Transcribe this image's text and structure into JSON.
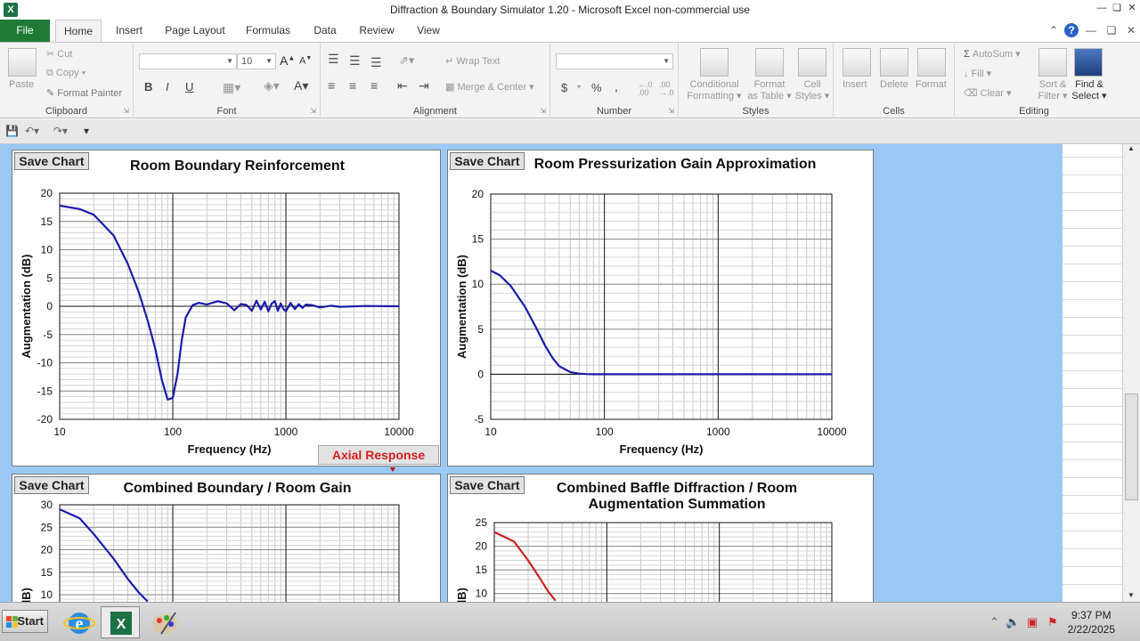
{
  "window": {
    "app_icon": "X",
    "title": "Diffraction & Boundary Simulator 1.20  -  Microsoft Excel non-commercial use"
  },
  "tabs": [
    "File",
    "Home",
    "Insert",
    "Page Layout",
    "Formulas",
    "Data",
    "Review",
    "View"
  ],
  "ribbon": {
    "clipboard": {
      "label": "Clipboard",
      "paste": "Paste",
      "cut": "Cut",
      "copy": "Copy",
      "format_painter": "Format Painter"
    },
    "font": {
      "label": "Font",
      "size": "10",
      "bold": "B",
      "italic": "I",
      "underline": "U"
    },
    "alignment": {
      "label": "Alignment",
      "wrap": "Wrap Text",
      "merge": "Merge & Center"
    },
    "number": {
      "label": "Number",
      "currency": "$",
      "percent": "%",
      "comma": ",",
      "inc_dec": ".00 →.0",
      "dec_dec": ".00"
    },
    "styles": {
      "label": "Styles",
      "conditional": "Conditional",
      "conditional2": "Formatting",
      "format_table": "Format",
      "format_table2": "as Table",
      "cell_styles": "Cell",
      "cell_styles2": "Styles"
    },
    "cells": {
      "label": "Cells",
      "insert": "Insert",
      "delete": "Delete",
      "format": "Format"
    },
    "editing": {
      "label": "Editing",
      "autosum": "AutoSum",
      "fill": "Fill",
      "clear": "Clear",
      "sort": "Sort &",
      "sort2": "Filter",
      "find": "Find &",
      "find2": "Select"
    }
  },
  "charts": {
    "save_label": "Save Chart",
    "axial_button": "Axial Response",
    "c1": {
      "title": "Room Boundary Reinforcement",
      "ylabel": "Augmentation (dB)",
      "xlabel": "Frequency (Hz)"
    },
    "c2": {
      "title": "Room Pressurization Gain Approximation",
      "ylabel": "Augmentation (dB)",
      "xlabel": "Frequency (Hz)"
    },
    "c3": {
      "title": "Combined Boundary / Room Gain"
    },
    "c4": {
      "title_line1": "Combined Baffle Diffraction / Room",
      "title_line2": "Augmentation Summation",
      "ylabel_partial": "(dB)"
    },
    "c3_ylabel_partial": "(dB)"
  },
  "chart_data": [
    {
      "type": "line",
      "title": "Room Boundary Reinforcement",
      "xlabel": "Frequency (Hz)",
      "ylabel": "Augmentation (dB)",
      "x_scale": "log",
      "xlim": [
        10,
        10000
      ],
      "ylim": [
        -20,
        20
      ],
      "x_ticks": [
        10,
        100,
        1000,
        10000
      ],
      "y_ticks": [
        20,
        15,
        10,
        5,
        0,
        -5,
        -10,
        -15,
        -20
      ],
      "series": [
        {
          "color": "#1b1baa",
          "x": [
            10,
            15,
            20,
            30,
            40,
            50,
            60,
            70,
            80,
            90,
            100,
            110,
            120,
            130,
            150,
            170,
            200,
            250,
            300,
            350,
            400,
            450,
            500,
            550,
            600,
            650,
            700,
            750,
            800,
            850,
            900,
            950,
            1000,
            1100,
            1200,
            1300,
            1400,
            1500,
            1700,
            2000,
            2500,
            3000,
            5000,
            10000
          ],
          "y": [
            17.8,
            17.2,
            16.2,
            12.5,
            7.5,
            2.5,
            -2.5,
            -7.5,
            -13,
            -16.5,
            -16.2,
            -12,
            -6,
            -2,
            0.2,
            0.6,
            0.3,
            0.9,
            0.5,
            -0.7,
            0.4,
            0.2,
            -0.8,
            1.0,
            -0.6,
            0.8,
            -0.9,
            0.5,
            0.9,
            -0.8,
            0.5,
            -0.5,
            -0.9,
            0.6,
            -0.5,
            0.4,
            -0.3,
            0.3,
            0.2,
            -0.2,
            0.1,
            -0.1,
            0.05,
            0
          ]
        }
      ],
      "grid": true
    },
    {
      "type": "line",
      "title": "Room Pressurization Gain Approximation",
      "xlabel": "Frequency (Hz)",
      "ylabel": "Augmentation (dB)",
      "x_scale": "log",
      "xlim": [
        10,
        10000
      ],
      "ylim": [
        -5,
        20
      ],
      "x_ticks": [
        10,
        100,
        1000,
        10000
      ],
      "y_ticks": [
        20,
        15,
        10,
        5,
        0,
        -5
      ],
      "series": [
        {
          "color": "#1b1baa",
          "x": [
            10,
            12,
            15,
            20,
            25,
            30,
            35,
            40,
            50,
            60,
            70,
            80,
            100,
            150,
            1000,
            10000
          ],
          "y": [
            11.5,
            11,
            9.8,
            7.5,
            5.2,
            3.2,
            1.8,
            0.9,
            0.25,
            0.07,
            0.02,
            0,
            0,
            0,
            0,
            0
          ]
        }
      ],
      "grid": true
    },
    {
      "type": "line",
      "title": "Combined Boundary / Room Gain",
      "x_scale": "log",
      "xlim": [
        10,
        10000
      ],
      "y_ticks": [
        30,
        25,
        20,
        15,
        10
      ],
      "series": [
        {
          "color": "#1b1baa",
          "x": [
            10,
            15,
            20,
            30,
            40,
            50,
            60
          ],
          "y": [
            29,
            27,
            23.5,
            18,
            13.5,
            10.5,
            8.5
          ]
        }
      ],
      "grid": true
    },
    {
      "type": "line",
      "title": "Combined Baffle Diffraction / Room Augmentation Summation",
      "x_scale": "log",
      "xlim": [
        10,
        10000
      ],
      "y_ticks": [
        25,
        20,
        15,
        10
      ],
      "series": [
        {
          "color": "#cc2222",
          "x": [
            10,
            15,
            20,
            25,
            30,
            35
          ],
          "y": [
            23,
            21,
            17,
            13.5,
            10.5,
            8.5
          ]
        }
      ],
      "grid": true
    }
  ],
  "taskbar": {
    "start": "Start",
    "time": "9:37 PM",
    "date": "2/22/2025"
  }
}
